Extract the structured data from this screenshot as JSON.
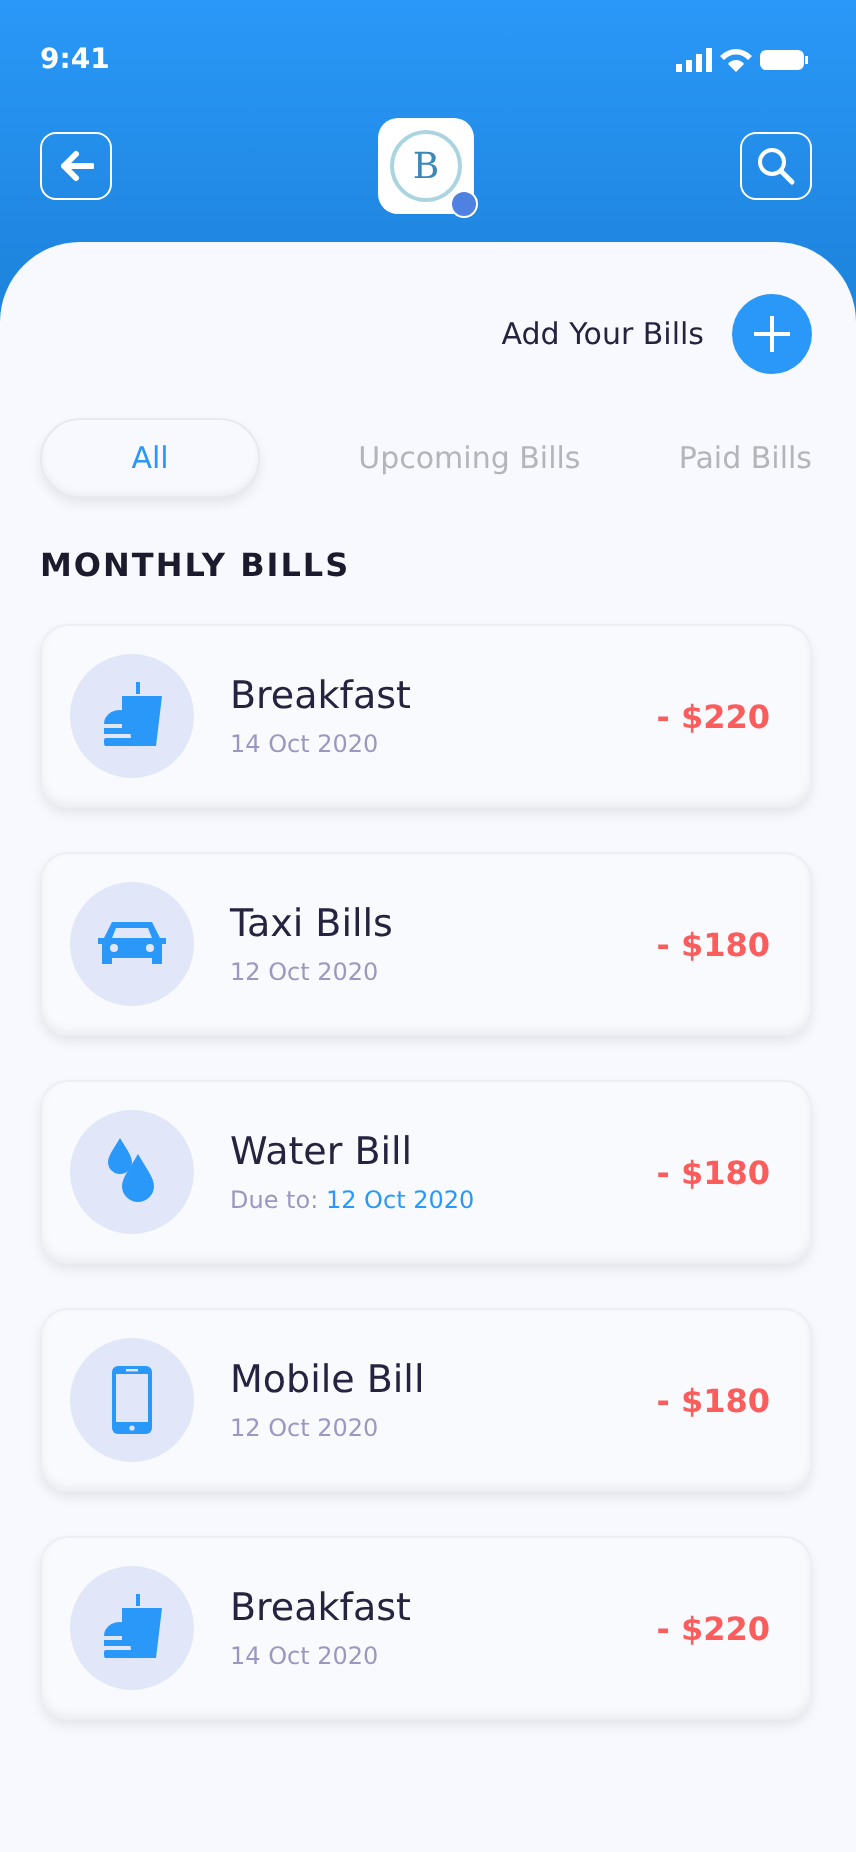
{
  "status_bar": {
    "time": "9:41"
  },
  "header": {
    "logo_text": "B"
  },
  "add_bills": {
    "label": "Add Your Bills"
  },
  "tabs": [
    {
      "label": "All",
      "selected": true
    },
    {
      "label": "Upcoming Bills",
      "selected": false
    },
    {
      "label": "Paid Bills",
      "selected": false
    }
  ],
  "section_title": "MONTHLY BILLS",
  "bills": [
    {
      "kind": "food",
      "title": "Breakfast",
      "date": "14 Oct 2020",
      "amount": "- $220"
    },
    {
      "kind": "car",
      "title": "Taxi Bills",
      "date": "12 Oct 2020",
      "amount": "- $180"
    },
    {
      "kind": "water",
      "title": "Water Bill",
      "due_label": "Due to:",
      "date": "12 Oct 2020",
      "amount": "- $180"
    },
    {
      "kind": "phone",
      "title": "Mobile Bill",
      "date": "12 Oct 2020",
      "amount": "- $180"
    },
    {
      "kind": "food",
      "title": "Breakfast",
      "date": "14 Oct 2020",
      "amount": "- $220"
    }
  ]
}
